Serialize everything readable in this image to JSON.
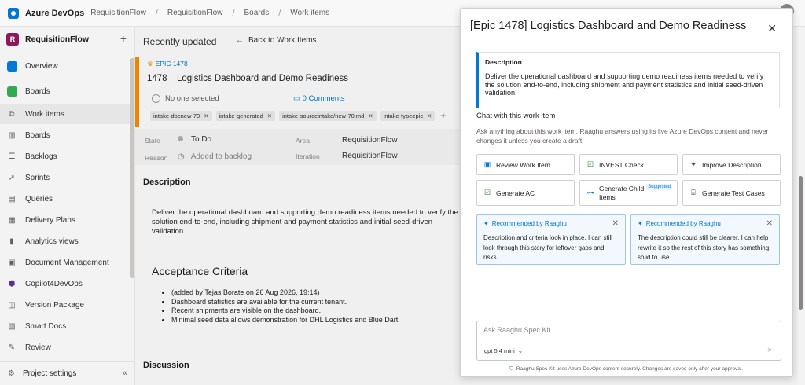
{
  "topbar": {
    "brand": "Azure DevOps",
    "breadcrumbs": [
      "RequisitionFlow",
      "RequisitionFlow",
      "Boards",
      "Work items"
    ]
  },
  "sidebar": {
    "project_initial": "R",
    "project_name": "RequisitionFlow",
    "items": [
      {
        "label": "Overview",
        "icon": "overview-icon"
      },
      {
        "label": "Boards",
        "icon": "boards-icon"
      },
      {
        "label": "Work items",
        "icon": "work-items-icon"
      },
      {
        "label": "Boards",
        "icon": "board-icon"
      },
      {
        "label": "Backlogs",
        "icon": "backlogs-icon"
      },
      {
        "label": "Sprints",
        "icon": "sprints-icon"
      },
      {
        "label": "Queries",
        "icon": "queries-icon"
      },
      {
        "label": "Delivery Plans",
        "icon": "delivery-plans-icon"
      },
      {
        "label": "Analytics views",
        "icon": "analytics-icon"
      },
      {
        "label": "Document Management",
        "icon": "document-icon"
      },
      {
        "label": "Copilot4DevOps",
        "icon": "copilot-icon"
      },
      {
        "label": "Version Package",
        "icon": "package-icon"
      },
      {
        "label": "Smart Docs",
        "icon": "smart-docs-icon"
      },
      {
        "label": "Review",
        "icon": "review-icon"
      }
    ],
    "settings_label": "Project settings"
  },
  "main": {
    "recently_updated": "Recently updated",
    "back_label": "Back to Work Items",
    "epic_tag": "EPIC 1478",
    "id": "1478",
    "title": "Logistics Dashboard and Demo Readiness",
    "assigned": "No one selected",
    "comments": "0 Comments",
    "tags": [
      "intake-docnew-70",
      "intake-generated",
      "intake-sourceintake/new-70.md",
      "intake-typeepic"
    ],
    "fields": {
      "state_label": "State",
      "state_value": "To Do",
      "reason_label": "Reason",
      "reason_value": "Added to backlog",
      "area_label": "Area",
      "area_value": "RequisitionFlow",
      "iteration_label": "Iteration",
      "iteration_value": "RequisitionFlow"
    },
    "description_heading": "Description",
    "description_text": "Deliver the operational dashboard and supporting demo readiness items needed to verify the solution end-to-end, including shipment and payment statistics and initial seed-driven validation.",
    "ac_heading": "Acceptance Criteria",
    "ac_items": [
      "(added by Tejas Borate on 26 Aug 2026, 19:14)",
      "Dashboard statistics are available for the current tenant.",
      "Recent shipments are visible on the dashboard.",
      "Minimal seed data allows demonstration for DHL Logistics and Blue Dart."
    ],
    "discussion_heading": "Discussion"
  },
  "panel": {
    "title": "[Epic 1478] Logistics Dashboard and Demo Readiness",
    "desc_title": "Description",
    "desc_body": "Deliver the operational dashboard and supporting demo readiness items needed to verify the solution end-to-end, including shipment and payment statistics and initial seed-driven validation.",
    "chat_heading": "Chat with this work item",
    "chat_sub": "Ask anything about this work item. Raaghu answers using its live Azure DevOps content and never changes it unless you create a draft.",
    "actions": [
      {
        "label": "Review Work Item",
        "icon": "review-icon"
      },
      {
        "label": "INVEST Check",
        "icon": "checklist-icon"
      },
      {
        "label": "Improve Description",
        "icon": "magic-wand-icon"
      },
      {
        "label": "Generate AC",
        "icon": "checkbox-icon"
      },
      {
        "label": "Generate Child Items",
        "icon": "hierarchy-icon",
        "badge": "Suggested"
      },
      {
        "label": "Generate Test Cases",
        "icon": "test-cases-icon"
      }
    ],
    "recommendations": [
      {
        "heading": "Recommended by Raaghu",
        "body": "Description and criteria look in place. I can still look through this story for leftover gaps and risks."
      },
      {
        "heading": "Recommended by Raaghu",
        "body": "The description could still be clearer. I can help rewrite it so the rest of this story has something solid to use."
      }
    ],
    "chat_placeholder": "Ask Raaghu Spec Kit",
    "model_label": "gpt 5.4  mini",
    "footer": "Raaghu Spec Kit uses Azure DevOps content securely. Changes are saved only after your approval."
  }
}
